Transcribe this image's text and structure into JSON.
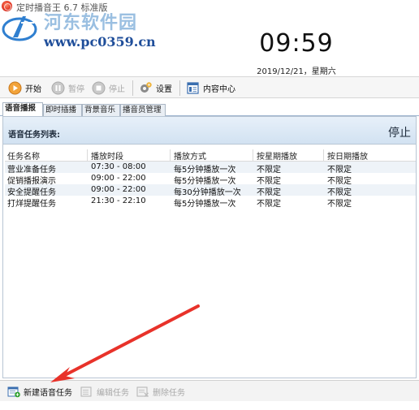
{
  "window": {
    "title": "定时播音王 6.7 标准版"
  },
  "watermark": {
    "text_cn": "河东软件园",
    "url": "www.pc0359.cn"
  },
  "clock": {
    "time": "09:59",
    "date": "2019/12/21，星期六"
  },
  "toolbar": {
    "start": "开始",
    "pause": "暂停",
    "stop": "停止",
    "settings": "设置",
    "content_center": "内容中心"
  },
  "tabs": [
    "语音播报",
    "即时插播",
    "背景音乐",
    "播音员管理"
  ],
  "panel": {
    "title": "语音任务列表:",
    "status": "停止",
    "columns": [
      "任务名称",
      "播放时段",
      "播放方式",
      "按星期播放",
      "按日期播放"
    ],
    "rows": [
      [
        "营业准备任务",
        "07:30 - 08:00",
        "每5分钟播放一次",
        "不限定",
        "不限定"
      ],
      [
        "促销播报演示",
        "09:00 - 22:00",
        "每5分钟播放一次",
        "不限定",
        "不限定"
      ],
      [
        "安全提醒任务",
        "09:00 - 22:00",
        "每30分钟播放一次",
        "不限定",
        "不限定"
      ],
      [
        "打烊提醒任务",
        "21:30 - 22:10",
        "每5分钟播放一次",
        "不限定",
        "不限定"
      ]
    ]
  },
  "bottombar": {
    "new_task": "新建语音任务",
    "edit_task": "编辑任务",
    "delete_task": "删除任务"
  },
  "colors": {
    "annotation_arrow": "#e8322a",
    "panel_header": "#d2e2f2",
    "watermark_url": "#1f4e9a"
  }
}
